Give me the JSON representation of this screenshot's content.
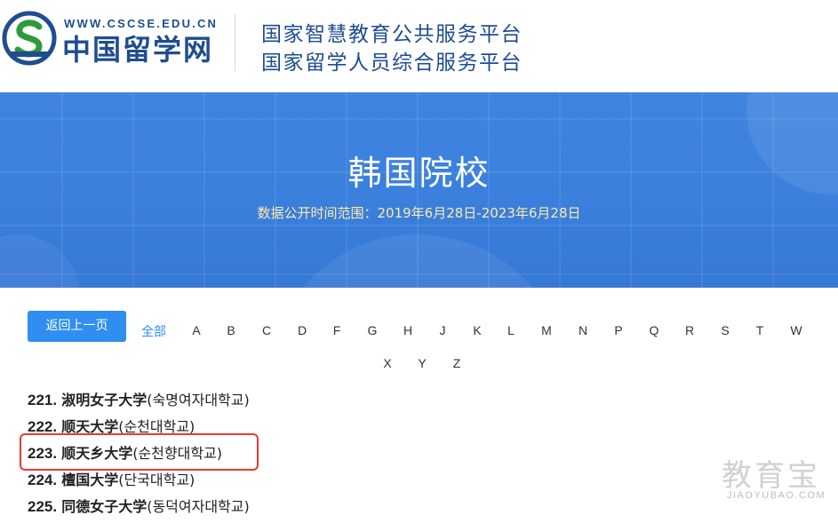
{
  "header": {
    "site_url": "WWW.CSCSE.EDU.CN",
    "site_name": "中国留学网",
    "platform_line1": "国家智慧教育公共服务平台",
    "platform_line2": "国家留学人员综合服务平台"
  },
  "banner": {
    "title": "韩国院校",
    "subtitle": "数据公开时间范围：2019年6月28日-2023年6月28日"
  },
  "filter": {
    "back_label": "返回上一页",
    "all_label": "全部",
    "letters_row1": [
      "A",
      "B",
      "C",
      "D",
      "F",
      "G",
      "H",
      "J",
      "K",
      "L",
      "M",
      "N",
      "P",
      "Q",
      "R",
      "S",
      "T",
      "W"
    ],
    "letters_row2": [
      "X",
      "Y",
      "Z"
    ]
  },
  "schools": [
    {
      "num": "221.",
      "cn": "淑明女子大学",
      "kr": "(숙명여자대학교)"
    },
    {
      "num": "222.",
      "cn": "顺天大学",
      "kr": "(순천대학교)"
    },
    {
      "num": "223.",
      "cn": "顺天乡大学",
      "kr": "(순천향대학교)"
    },
    {
      "num": "224.",
      "cn": "檀国大学",
      "kr": "(단국대학교)"
    },
    {
      "num": "225.",
      "cn": "同德女子大学",
      "kr": "(동덕여자대학교)"
    }
  ],
  "watermark": {
    "title": "教育宝",
    "url": "JIAOYUBAO.COM"
  },
  "colors": {
    "brand_blue": "#1f4d8f",
    "banner_blue": "#3a7fdc",
    "accent_blue": "#2f8ef0",
    "highlight_red": "#e83a2e",
    "subtitle_yellow": "#ffe9a8"
  }
}
